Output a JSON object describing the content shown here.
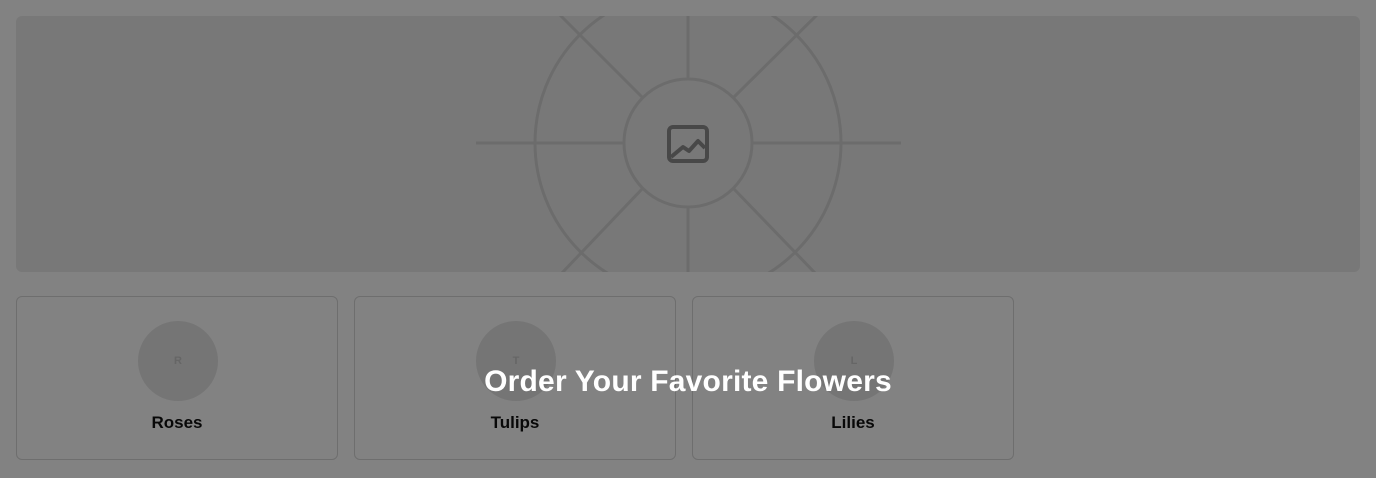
{
  "hero": {
    "image_icon": "image-placeholder-icon"
  },
  "categories": [
    {
      "label": "Roses",
      "avatar_initial": "R"
    },
    {
      "label": "Tulips",
      "avatar_initial": "T"
    },
    {
      "label": "Lilies",
      "avatar_initial": "L"
    }
  ],
  "overlay": {
    "title": "Order Your Favorite Flowers"
  },
  "colors": {
    "overlay": "#000000",
    "placeholder_bg": "#ececec",
    "avatar_bg": "#e6e6e6"
  }
}
